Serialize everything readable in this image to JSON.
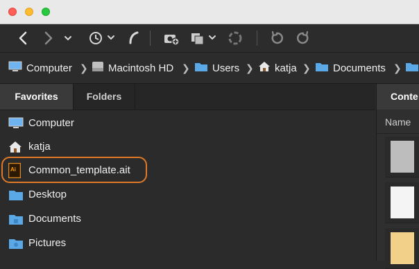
{
  "breadcrumb": [
    {
      "label": "Computer",
      "icon": "display-icon"
    },
    {
      "label": "Macintosh HD",
      "icon": "hard-drive-icon"
    },
    {
      "label": "Users",
      "icon": "folder-icon"
    },
    {
      "label": "katja",
      "icon": "home-icon"
    },
    {
      "label": "Documents",
      "icon": "folder-icon"
    }
  ],
  "sidebar": {
    "tabs": [
      {
        "label": "Favorites",
        "active": true
      },
      {
        "label": "Folders",
        "active": false
      }
    ],
    "items": [
      {
        "label": "Computer",
        "icon": "display-icon"
      },
      {
        "label": "katja",
        "icon": "home-icon"
      },
      {
        "label": "Common_template.ait",
        "icon": "illustrator-file-icon",
        "highlighted": true
      },
      {
        "label": "Desktop",
        "icon": "folder-icon"
      },
      {
        "label": "Documents",
        "icon": "folder-icon"
      },
      {
        "label": "Pictures",
        "icon": "folder-icon"
      }
    ]
  },
  "content": {
    "title": "Conte",
    "column_header": "Name"
  },
  "colors": {
    "highlight": "#e07a28",
    "folder": "#5aa9e6",
    "accent_dark": "#2b2b2b"
  }
}
